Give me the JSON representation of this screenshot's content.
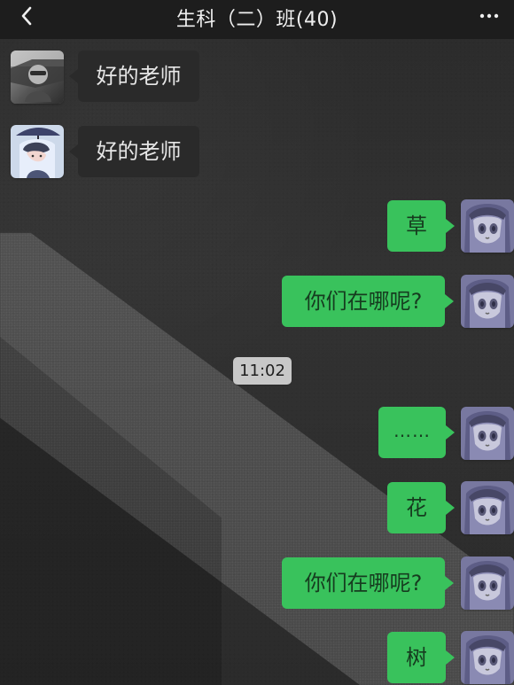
{
  "header": {
    "title": "生科（二）班(40)",
    "back_icon": "chevron-left-icon",
    "more_icon": "more-horizontal-icon"
  },
  "messages": [
    {
      "side": "left",
      "text": "好的老师",
      "avatar": "car-selfie-avatar"
    },
    {
      "side": "left",
      "text": "好的老师",
      "avatar": "anime-boy-umbrella-avatar"
    },
    {
      "side": "right",
      "text": "草",
      "avatar": "anime-girl-avatar"
    },
    {
      "side": "right",
      "text": "你们在哪呢?",
      "avatar": "anime-girl-avatar"
    },
    {
      "side": "system",
      "text": "11:02"
    },
    {
      "side": "right",
      "text": "……",
      "avatar": "anime-girl-avatar"
    },
    {
      "side": "right",
      "text": "花",
      "avatar": "anime-girl-avatar"
    },
    {
      "side": "right",
      "text": "你们在哪呢?",
      "avatar": "anime-girl-avatar"
    },
    {
      "side": "right",
      "text": "树",
      "avatar": "anime-girl-avatar"
    }
  ],
  "colors": {
    "header_bg": "#1d1d1d",
    "left_bubble_bg": "#2a2a2a",
    "right_bubble_bg": "#39c25c",
    "timestamp_bg": "#c8c8c8",
    "background": "#2f2f2f"
  }
}
